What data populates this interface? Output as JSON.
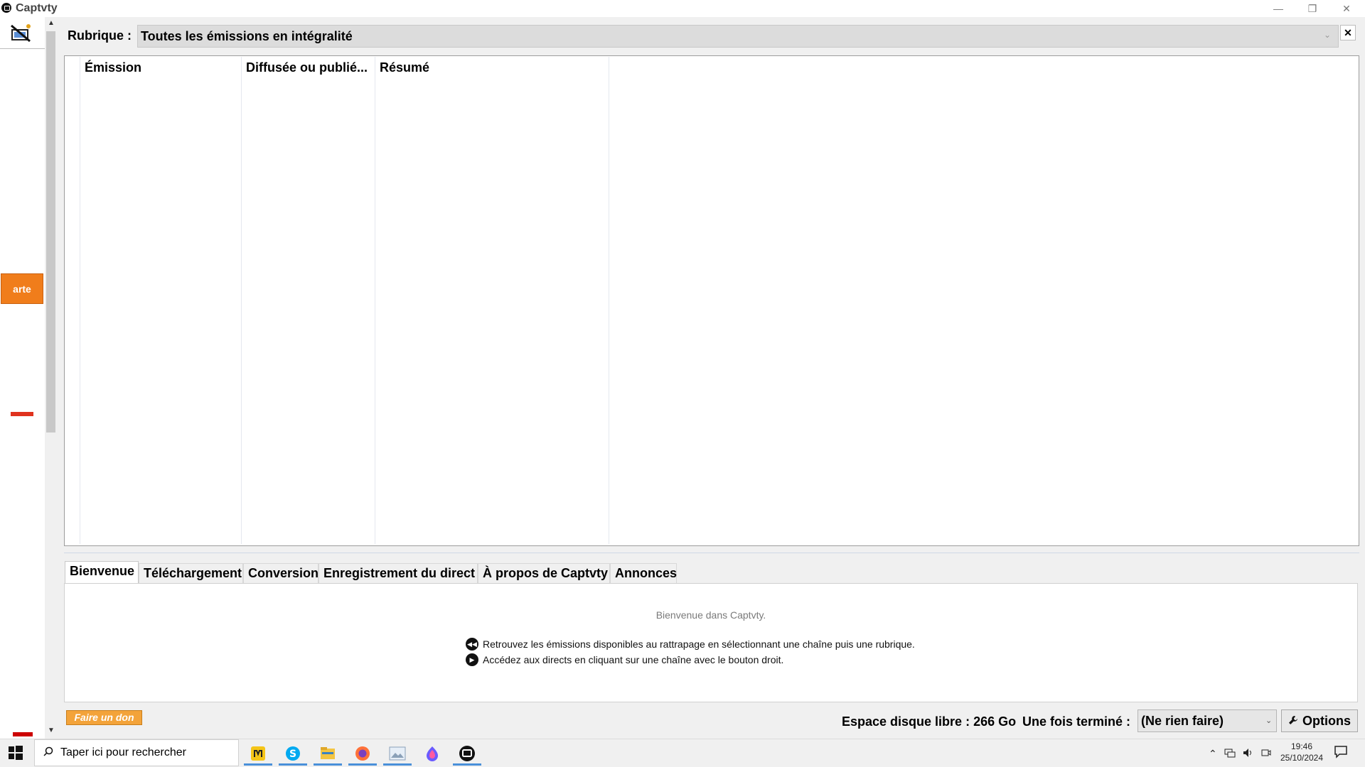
{
  "window": {
    "title": "Captvty",
    "controls": [
      "minimize",
      "restore",
      "close"
    ]
  },
  "sidebar": {
    "channels": [
      {
        "name": "arte",
        "logo_color": "#f07d1b"
      }
    ]
  },
  "rubrique": {
    "label": "Rubrique :",
    "selected": "Toutes les émissions en intégralité"
  },
  "list": {
    "columns": [
      "Émission",
      "Diffusée ou publié...",
      "Résumé"
    ],
    "rows": []
  },
  "tabs": [
    {
      "label": "Bienvenue",
      "active": true
    },
    {
      "label": "Téléchargement",
      "active": false
    },
    {
      "label": "Conversion",
      "active": false
    },
    {
      "label": "Enregistrement du direct",
      "active": false
    },
    {
      "label": "À propos de Captvty",
      "active": false
    },
    {
      "label": "Annonces",
      "active": false
    }
  ],
  "welcome": {
    "title": "Bienvenue dans Captvty.",
    "line1": "Retrouvez les émissions disponibles au rattrapage en sélectionnant une chaîne puis une rubrique.",
    "line2": "Accédez aux directs en cliquant sur une chaîne avec le bouton droit."
  },
  "footer": {
    "donate_label": "Faire un don",
    "disk_space": "Espace disque libre : 266 Go",
    "when_done_label": "Une fois terminé :",
    "when_done_value": "(Ne rien faire)",
    "options_label": "Options"
  },
  "taskbar": {
    "search_placeholder": "Taper ici pour rechercher",
    "apps": [
      "notes-app",
      "skype",
      "file-explorer",
      "firefox",
      "photos",
      "firefox-dev",
      "captvty"
    ],
    "time": "19:46",
    "date": "25/10/2024"
  },
  "colors": {
    "accent_orange": "#f3a33a",
    "arte_orange": "#f07d1b",
    "taskbar_active": "#4a90d9"
  }
}
